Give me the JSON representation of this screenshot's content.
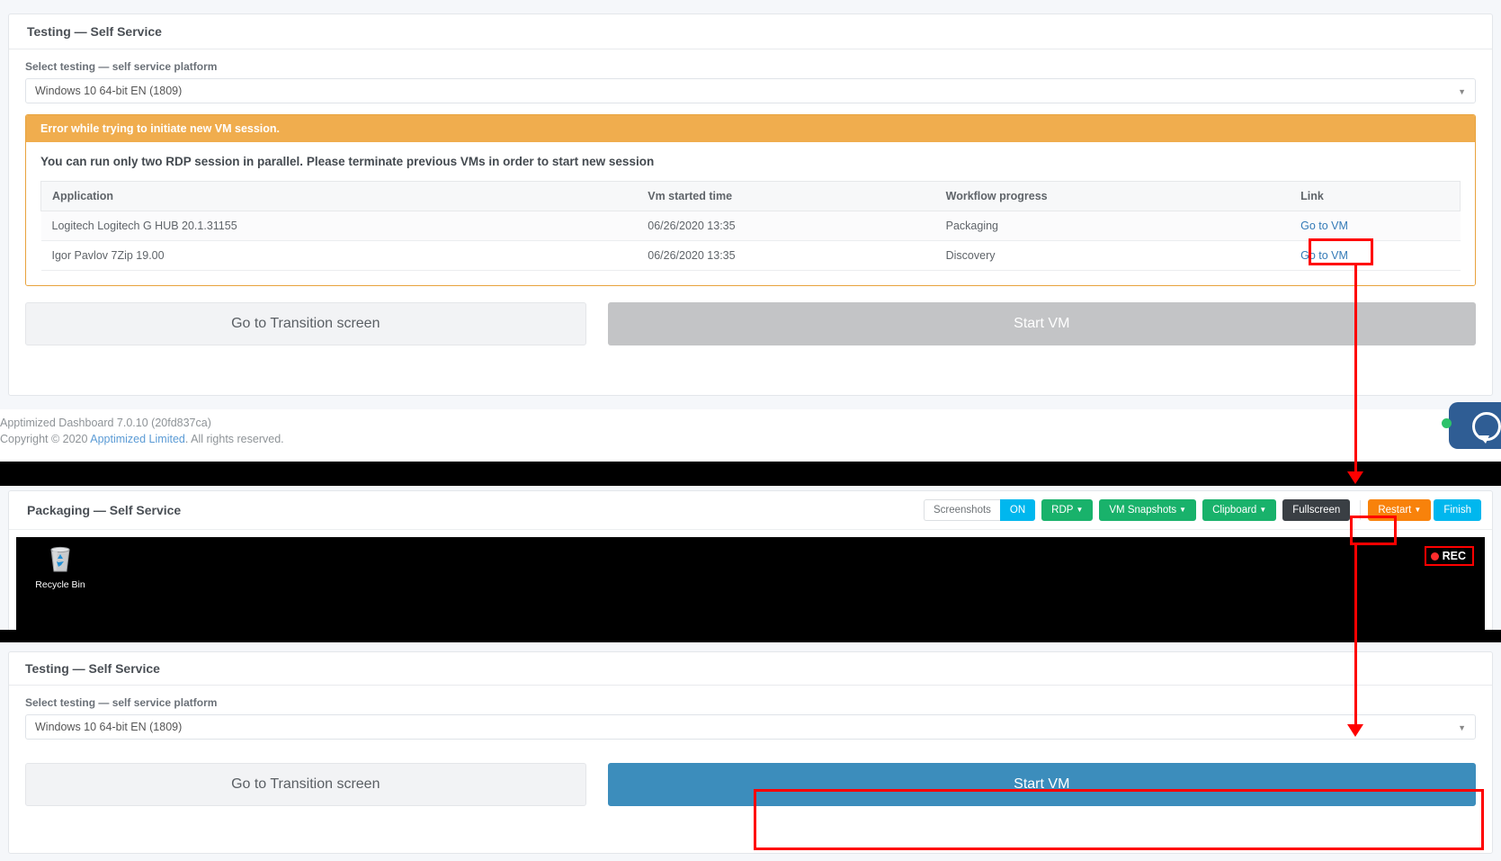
{
  "top_panel": {
    "title": "Testing — Self Service",
    "select_label": "Select testing — self service platform",
    "platform_value": "Windows 10 64-bit EN (1809)",
    "caret_icon": "chevron-down-icon",
    "alert": {
      "heading": "Error while trying to initiate new VM session.",
      "message": "You can run only two RDP session in parallel. Please terminate previous VMs in order to start new session"
    },
    "table": {
      "columns": [
        "Application",
        "Vm started time",
        "Workflow progress",
        "Link"
      ],
      "rows": [
        {
          "application": "Logitech Logitech G HUB 20.1.31155",
          "vm_started_time": "06/26/2020 13:35",
          "workflow_progress": "Packaging",
          "link": "Go to VM"
        },
        {
          "application": "Igor Pavlov 7Zip 19.00",
          "vm_started_time": "06/26/2020 13:35",
          "workflow_progress": "Discovery",
          "link": "Go to VM"
        }
      ]
    },
    "buttons": {
      "transition": "Go to Transition screen",
      "start_vm": "Start VM"
    }
  },
  "footer": {
    "version_line": "Apptimized Dashboard 7.0.10 (20fd837ca)",
    "copyright_prefix": "Copyright © 2020 ",
    "copyright_link": "Apptimized Limited",
    "copyright_suffix": ". All rights reserved."
  },
  "vm_panel": {
    "title": "Packaging — Self Service",
    "toolbar": {
      "screenshots_label": "Screenshots",
      "screenshots_state": "ON",
      "rdp": "RDP",
      "vm_snapshots": "VM Snapshots",
      "clipboard": "Clipboard",
      "fullscreen": "Fullscreen",
      "restart": "Restart",
      "finish": "Finish",
      "caret_icon": "caret-down-icon"
    },
    "desktop": {
      "recycle_bin_label": "Recycle Bin",
      "recycle_bin_icon": "recycle-bin-icon",
      "rec_badge": "REC",
      "rec_dot_icon": "record-dot-icon"
    }
  },
  "bottom_panel": {
    "title": "Testing — Self Service",
    "select_label": "Select testing — self service platform",
    "platform_value": "Windows 10 64-bit EN (1809)",
    "caret_icon": "chevron-down-icon",
    "buttons": {
      "transition": "Go to Transition screen",
      "start_vm": "Start VM"
    }
  },
  "chat_widget": {
    "icon": "chat-bubble-icon",
    "status_icon": "online-status-dot"
  },
  "colors": {
    "alert_orange": "#f0ad4e",
    "link_blue": "#337ab7",
    "primary_blue": "#3c8dbc",
    "toolbar_green": "#19b26b",
    "toolbar_cyan": "#00b7ee",
    "toolbar_orange": "#f8820b",
    "toolbar_dark": "#3a3f44",
    "annotation_red": "#ff0000"
  }
}
